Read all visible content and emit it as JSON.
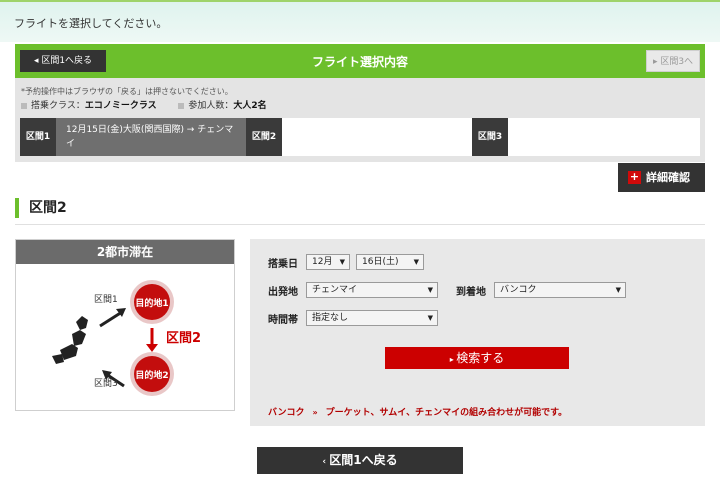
{
  "intro_text": "フライトを選択してください。",
  "header": {
    "title": "フライト選択内容",
    "back_label": "区間1へ戻る",
    "next_label": "区間3へ"
  },
  "summary": {
    "note": "*予約操作中はブラウザの「戻る」は押さないでください。",
    "class_label": "搭乗クラス：",
    "class_value": "エコノミークラス",
    "pax_label": "参加人数：",
    "pax_value": "大人2名",
    "segments": [
      {
        "tag": "区間1",
        "text": "12月15日(金)大阪(関西国際) → チェンマイ"
      },
      {
        "tag": "区間2",
        "text": ""
      },
      {
        "tag": "区間3",
        "text": ""
      }
    ]
  },
  "detail_button": "詳細確認",
  "section_title": "区間2",
  "stay": {
    "title": "2都市滞在",
    "seg1_label": "区間1",
    "seg2_label": "区間2",
    "seg3_label": "区間3",
    "dest1": "目的地1",
    "dest2": "目的地2"
  },
  "form": {
    "date_label": "搭乗日",
    "month_value": "12月",
    "day_value": "16日(土)",
    "origin_label": "出発地",
    "origin_value": "チェンマイ",
    "dest_label": "到着地",
    "dest_value": "バンコク",
    "time_label": "時間帯",
    "time_value": "指定なし",
    "search_label": "検索する",
    "combo_city": "バンコク",
    "combo_arrows": "»",
    "combo_text": "プーケット、サムイ、チェンマイの組み合わせが可能です。"
  },
  "bottom_back_label": "区間1へ戻る",
  "colors": {
    "green": "#6cbf2c",
    "red": "#cc0000",
    "dark": "#333333"
  }
}
